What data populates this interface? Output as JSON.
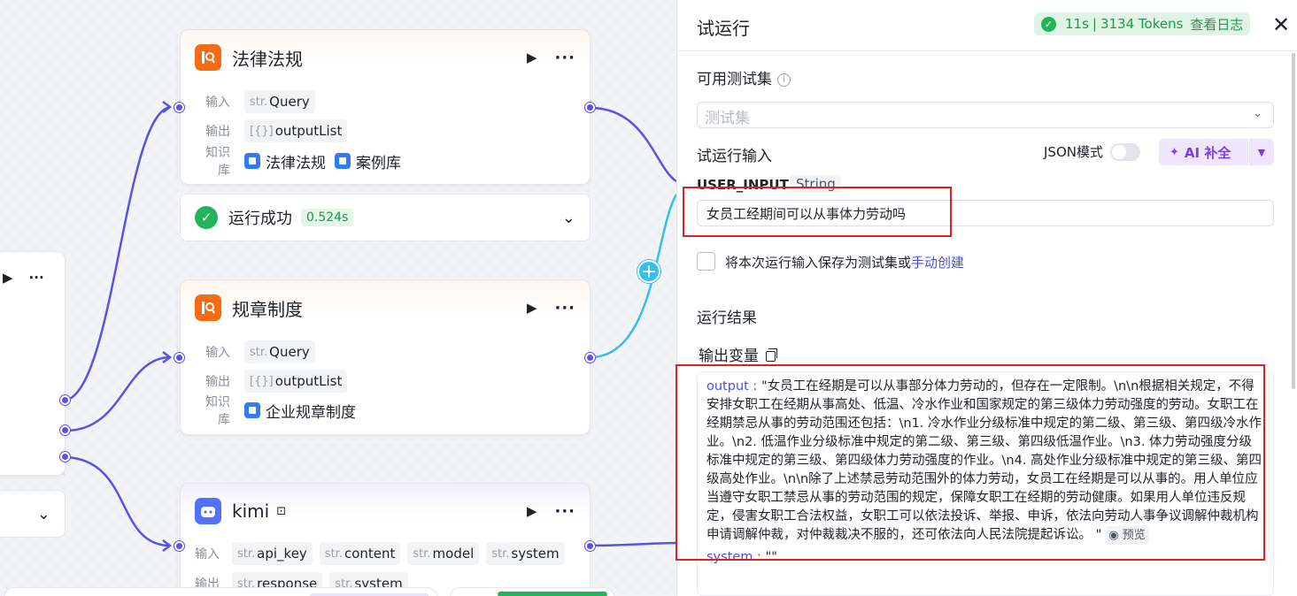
{
  "nodes": {
    "law": {
      "title": "法律法规",
      "input_label": "输入",
      "output_label": "输出",
      "kb_label": "知识库",
      "input_type": "str.",
      "input_name": "Query",
      "output_type": "[{}]",
      "output_name": "outputList",
      "kb_items": [
        "法律法规",
        "案例库"
      ]
    },
    "law_status": {
      "text": "运行成功",
      "time": "0.524s"
    },
    "rules": {
      "title": "规章制度",
      "input_label": "输入",
      "output_label": "输出",
      "kb_label": "知识库",
      "input_type": "str.",
      "input_name": "Query",
      "output_type": "[{}]",
      "output_name": "outputList",
      "kb_items": [
        "企业规章制度"
      ]
    },
    "kimi": {
      "title": "kimi",
      "input_label": "输入",
      "output_label": "输出",
      "inputs": [
        {
          "type": "str.",
          "name": "api_key"
        },
        {
          "type": "str.",
          "name": "content"
        },
        {
          "type": "str.",
          "name": "model"
        },
        {
          "type": "str.",
          "name": "system"
        }
      ],
      "outputs": [
        {
          "type": "str.",
          "name": "response"
        },
        {
          "type": "str.",
          "name": "system"
        }
      ]
    }
  },
  "panel": {
    "title": "试运行",
    "run_time": "11s",
    "run_tokens": "3134 Tokens",
    "view_log": "查看日志",
    "test_set_label": "可用测试集",
    "test_set_placeholder": "测试集",
    "run_input_label": "试运行输入",
    "json_mode_label": "JSON模式",
    "ai_fill_label": "AI 补全",
    "var_name": "USER_INPUT",
    "var_type": "String",
    "input_value": "女员工经期间可以从事体力劳动吗",
    "save_label": "将本次运行输入保存为测试集或",
    "manual_create": "手动创建",
    "result_label": "运行结果",
    "output_vars_label": "输出变量",
    "output_key": "output",
    "output_value": "\"女员工在经期是可以从事部分体力劳动的，但存在一定限制。\\n\\n根据相关规定，不得安排女职工在经期从事高处、低温、冷水作业和国家规定的第三级体力劳动强度的劳动。女职工在经期禁忌从事的劳动范围还包括：\\n1. 冷水作业分级标准中规定的第二级、第三级、第四级冷水作业。\\n2. 低温作业分级标准中规定的第二级、第三级、第四级低温作业。\\n3. 体力劳动强度分级标准中规定的第三级、第四级体力劳动强度的作业。\\n4. 高处作业分级标准中规定的第三级、第四级高处作业。\\n\\n除了上述禁忌劳动范围外的体力劳动，女员工在经期是可以从事的。用人单位应当遵守女职工禁忌从事的劳动范围的规定，保障女职工在经期的劳动健康。如果用人单位违反规定，侵害女职工合法权益，女职工可以依法投诉、举报、申诉，依法向劳动人事争议调解仲裁机构申请调解仲裁，对仲裁裁决不服的，还可依法向人民法院提起诉讼。 \"",
    "preview_label": "预览",
    "system_key": "system",
    "system_value": "\"\""
  },
  "colors": {
    "edge": "#5a52e8",
    "edge_cyan": "#33bff0",
    "success": "#22b45a",
    "accent_purple": "#7a3cf0",
    "highlight_red": "#e02020"
  }
}
